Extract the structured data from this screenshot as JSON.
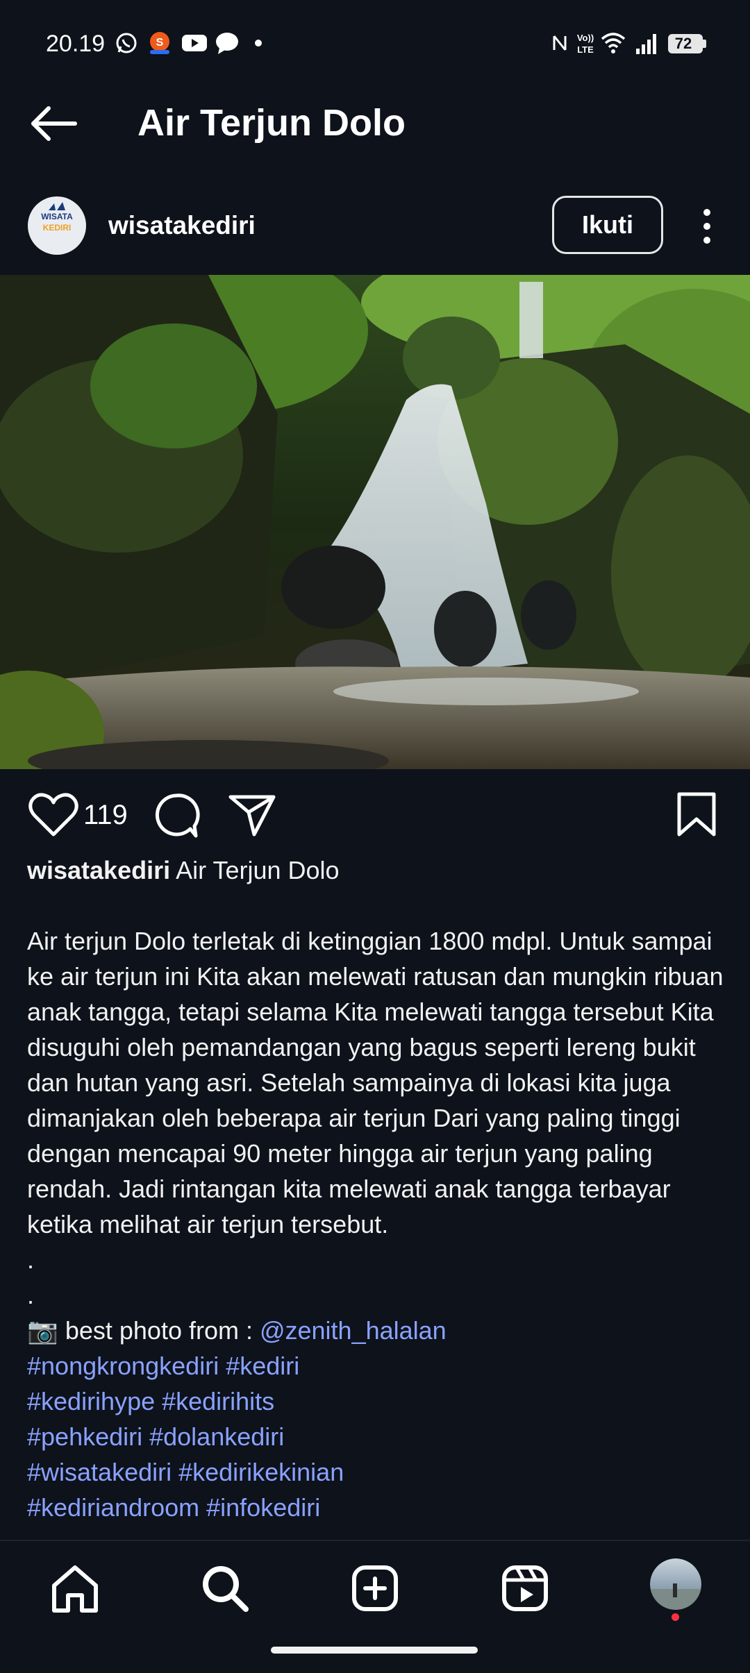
{
  "status": {
    "time": "20.19",
    "battery": "72",
    "icons": [
      "whatsapp-icon",
      "shopee-icon",
      "youtube-icon",
      "messenger-icon",
      "dot-icon",
      "nfc-icon",
      "volte-icon",
      "wifi-icon",
      "signal-icon",
      "battery-icon"
    ]
  },
  "header": {
    "title": "Air Terjun Dolo"
  },
  "post": {
    "username": "wisatakediri",
    "avatar_text": [
      "WISATA",
      "KEDIRI"
    ],
    "follow_label": "Ikuti",
    "like_count": "119",
    "caption": {
      "user": "wisatakediri",
      "title": "Air Terjun Dolo",
      "body": "Air terjun Dolo terletak di ketinggian 1800 mdpl. Untuk sampai ke air terjun ini Kita akan melewati ratusan dan mungkin ribuan anak tangga, tetapi selama Kita melewati tangga tersebut Kita disuguhi oleh pemandangan yang bagus seperti lereng bukit dan hutan yang asri. Setelah sampainya di lokasi kita juga dimanjakan oleh beberapa air terjun Dari yang paling tinggi dengan mencapai 90 meter hingga air terjun yang paling rendah. Jadi rintangan kita melewati anak tangga terbayar ketika melihat air terjun tersebut.",
      "dot1": ".",
      "dot2": ".",
      "photo_credit_prefix": "📷 best photo from : ",
      "photo_credit_link": "@zenith_halalan",
      "hashtag_lines": [
        "#nongkrongkediri #kediri",
        "#kedirihype #kedirihits",
        "#pehkediri #dolankediri",
        "#wisatakediri #kedirikekinian",
        "#kediriandroom #infokediri"
      ]
    }
  },
  "nav": {
    "items": [
      "home-icon",
      "search-icon",
      "create-icon",
      "reels-icon",
      "profile-avatar"
    ]
  },
  "colors": {
    "background": "#0d121b",
    "link": "#8aa2ff",
    "notification_dot": "#ff3040"
  }
}
